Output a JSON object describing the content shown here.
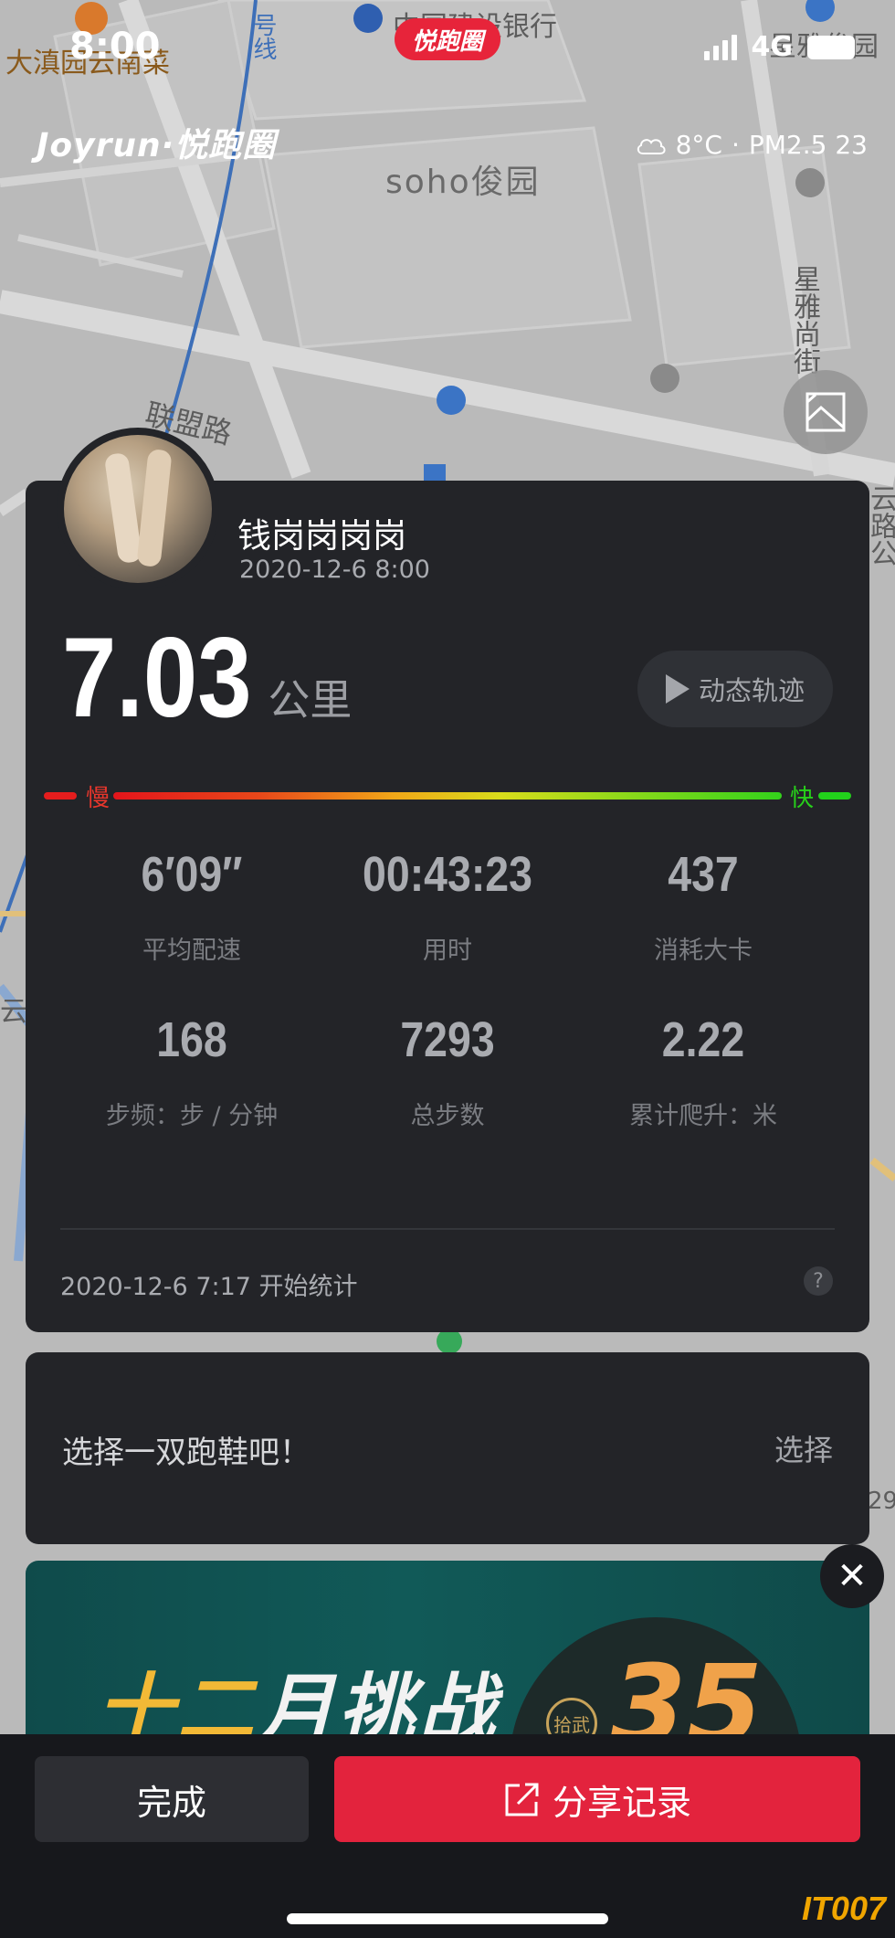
{
  "status_bar": {
    "time": "8:00",
    "network": "4G"
  },
  "app": {
    "brand_pill": "悦跑圈",
    "logo": "Joyrun·悦跑圈"
  },
  "weather": {
    "temperature": "8°C",
    "separator": "·",
    "air_quality": "PM2.5 23",
    "icon": "cloud-icon"
  },
  "map": {
    "labels": {
      "poi_top_left": "大滇园云南菜",
      "bank": "中国建设银行",
      "poi_top_right": "星雅俊园",
      "estate": "soho俊园",
      "road_lianmeng": "联盟路",
      "street_xingya": "星雅尚街",
      "side_right": "云路公",
      "side_left": "云南",
      "line_label": "号线",
      "number_right": "29"
    }
  },
  "run": {
    "user_name": "钱岗岗岗岗",
    "run_datetime": "2020-12-6 8:00",
    "distance_value": "7.03",
    "distance_unit": "公里",
    "track_button_label": "动态轨迹",
    "speed_slow_label": "慢",
    "speed_fast_label": "快",
    "stats": [
      {
        "value": "6′09″",
        "label": "平均配速"
      },
      {
        "value": "00:43:23",
        "label": "用时"
      },
      {
        "value": "437",
        "label": "消耗大卡"
      },
      {
        "value": "168",
        "label": "步频：步 / 分钟"
      },
      {
        "value": "7293",
        "label": "总步数"
      },
      {
        "value": "2.22",
        "label": "累计爬升：米"
      }
    ],
    "start_text": "2020-12-6 7:17 开始统计",
    "help_symbol": "?"
  },
  "shoe": {
    "prompt": "选择一双跑鞋吧！",
    "select_label": "选择"
  },
  "banner": {
    "title_part1": "十二",
    "title_part2": "月挑战",
    "badge_text": "拾武",
    "number": "35"
  },
  "actions": {
    "close_symbol": "✕",
    "done_label": "完成",
    "share_label": "分享记录"
  },
  "watermark": "IT007"
}
